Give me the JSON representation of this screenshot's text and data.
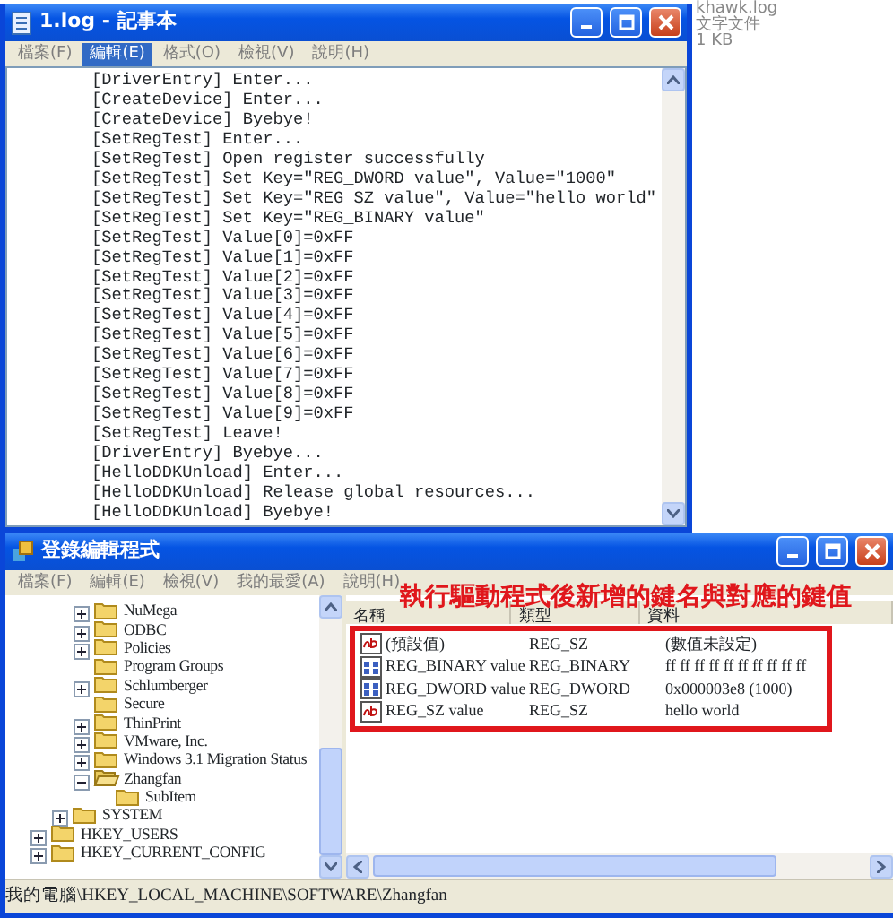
{
  "notepad": {
    "title": "1.log - 記事本",
    "menu": [
      {
        "label": "檔案(F)",
        "selected": false
      },
      {
        "label": "編輯(E)",
        "selected": true
      },
      {
        "label": "格式(O)",
        "selected": false
      },
      {
        "label": "檢視(V)",
        "selected": false
      },
      {
        "label": "說明(H)",
        "selected": false
      }
    ],
    "lines": [
      "[DriverEntry] Enter...",
      "[CreateDevice] Enter...",
      "[CreateDevice] Byebye!",
      "[SetRegTest] Enter...",
      "[SetRegTest] Open register successfully",
      "[SetRegTest] Set Key=\"REG_DWORD value\", Value=\"1000\"",
      "[SetRegTest] Set Key=\"REG_SZ value\", Value=\"hello world\"",
      "[SetRegTest] Set Key=\"REG_BINARY value\"",
      "[SetRegTest] Value[0]=0xFF",
      "[SetRegTest] Value[1]=0xFF",
      "[SetRegTest] Value[2]=0xFF",
      "[SetRegTest] Value[3]=0xFF",
      "[SetRegTest] Value[4]=0xFF",
      "[SetRegTest] Value[5]=0xFF",
      "[SetRegTest] Value[6]=0xFF",
      "[SetRegTest] Value[7]=0xFF",
      "[SetRegTest] Value[8]=0xFF",
      "[SetRegTest] Value[9]=0xFF",
      "[SetRegTest] Leave!",
      "[DriverEntry] Byebye...",
      "[HelloDDKUnload] Enter...",
      "[HelloDDKUnload] Release global resources...",
      "[HelloDDKUnload] Byebye!"
    ]
  },
  "file_info": [
    "khawk.log",
    "文字文件",
    "1 KB"
  ],
  "regedit": {
    "title": "登錄編輯程式",
    "menu": [
      {
        "label": "檔案(F)",
        "selected": false
      },
      {
        "label": "編輯(E)",
        "selected": false
      },
      {
        "label": "檢視(V)",
        "selected": false
      },
      {
        "label": "我的最愛(A)",
        "selected": false
      },
      {
        "label": "說明(H)",
        "selected": false
      }
    ],
    "tree": [
      {
        "children": [
          {
            "children": [
              {
                "label": "NuMega",
                "expanded": false,
                "expandable": true
              },
              {
                "label": "ODBC",
                "expanded": false,
                "expandable": true
              },
              {
                "label": "Policies",
                "expanded": false,
                "expandable": true
              },
              {
                "label": "Program Groups",
                "expanded": false,
                "expandable": false
              },
              {
                "label": "Schlumberger",
                "expanded": false,
                "expandable": true
              },
              {
                "label": "Secure",
                "expanded": false,
                "expandable": false
              },
              {
                "label": "ThinPrint",
                "expanded": false,
                "expandable": true
              },
              {
                "label": "VMware, Inc.",
                "expanded": false,
                "expandable": true
              },
              {
                "label": "Windows 3.1 Migration Status",
                "expanded": false,
                "expandable": true
              },
              {
                "label": "Zhangfan",
                "expanded": true,
                "expandable": true,
                "children": [
                  {
                    "label": "SubItem",
                    "expanded": false,
                    "expandable": false
                  }
                ]
              }
            ]
          },
          {
            "label": "SYSTEM",
            "expanded": false,
            "expandable": true
          }
        ]
      },
      {
        "label": "HKEY_USERS",
        "expanded": false,
        "expandable": true
      },
      {
        "label": "HKEY_CURRENT_CONFIG",
        "expanded": false,
        "expandable": true
      }
    ],
    "annotation": "執行驅動程式後新增的鍵名與對應的鍵值",
    "columns": [
      "名稱",
      "類型",
      "資料"
    ],
    "values": [
      {
        "kind": "string",
        "name": "(預設值)",
        "type": "REG_SZ",
        "data": "(數值未設定)"
      },
      {
        "kind": "binary",
        "name": "REG_BINARY value",
        "type": "REG_BINARY",
        "data": "ff ff ff ff ff ff ff ff ff ff"
      },
      {
        "kind": "binary",
        "name": "REG_DWORD value",
        "type": "REG_DWORD",
        "data": "0x000003e8 (1000)"
      },
      {
        "kind": "string",
        "name": "REG_SZ value",
        "type": "REG_SZ",
        "data": "hello world"
      }
    ],
    "status": "我的電腦\\HKEY_LOCAL_MACHINE\\SOFTWARE\\Zhangfan"
  }
}
